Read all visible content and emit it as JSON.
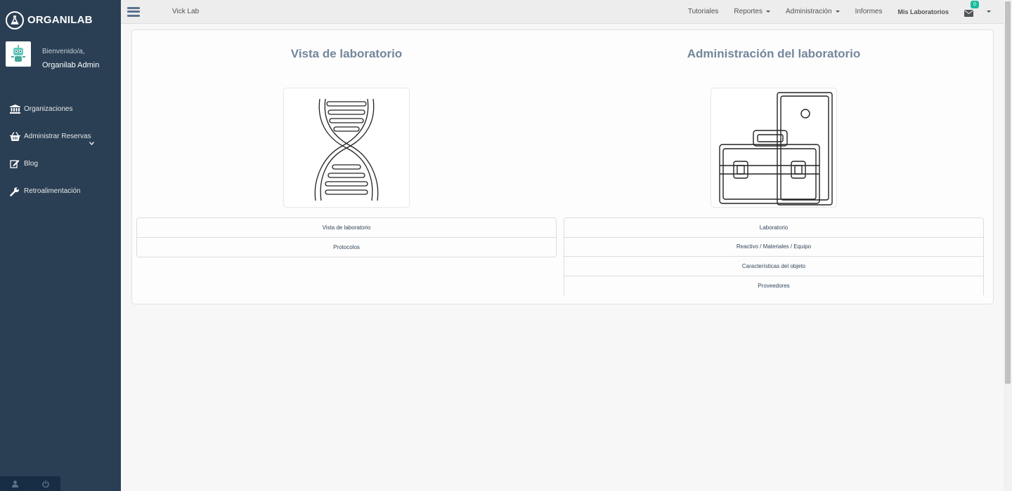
{
  "brand": {
    "name": "ORGANILAB",
    "logo_icon": "flask-icon"
  },
  "profile": {
    "welcome": "Bienvenido/a,",
    "username": "Organilab Admin"
  },
  "sidebar": {
    "items": [
      {
        "label": "Organizaciones",
        "icon": "institution-icon"
      },
      {
        "label": "Administrar Reservas",
        "icon": "basket-icon"
      },
      {
        "label": "Blog",
        "icon": "edit-icon"
      },
      {
        "label": "Retroalimentación",
        "icon": "wrench-icon"
      }
    ]
  },
  "topnav": {
    "lab_name": "Vick Lab",
    "links": [
      {
        "label": "Tutoriales"
      },
      {
        "label": "Reportes"
      },
      {
        "label": "Administración"
      },
      {
        "label": "Informes"
      },
      {
        "label": "Mis Laboratorios"
      }
    ],
    "notifications": {
      "count": "0",
      "accent": "#1abb9c"
    }
  },
  "main": {
    "left": {
      "title": "Vista de laboratorio",
      "image_icon": "dna-icon",
      "items": [
        "Vista de laboratorio",
        "Protocolos"
      ]
    },
    "right": {
      "title": "Administración del laboratorio",
      "image_icon": "toolbox-icon",
      "items": [
        "Laboratorio",
        "Reactivo / Materiales / Equipo",
        "Características del objeto",
        "Proveedores"
      ]
    }
  },
  "colors": {
    "sidebar": "#2a3f54",
    "title": "#73879c",
    "link": "#33465a"
  }
}
